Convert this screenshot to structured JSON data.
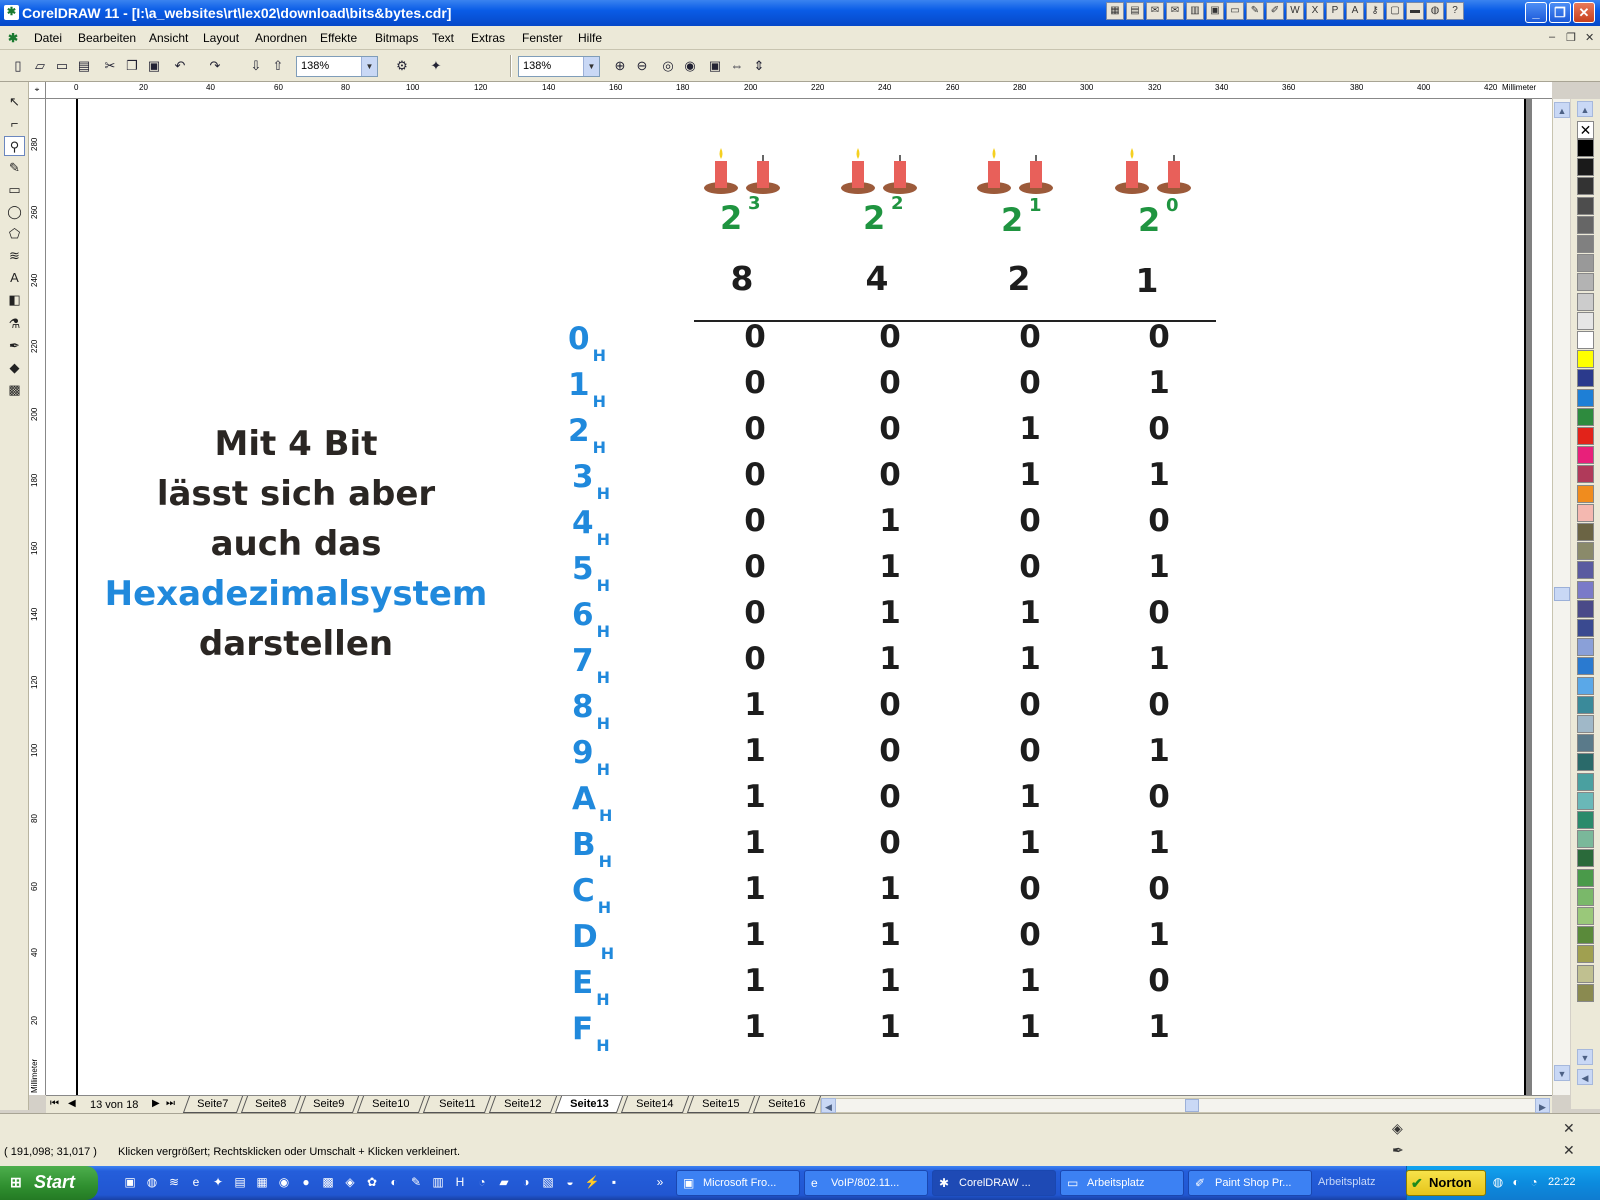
{
  "window": {
    "title": "CorelDRAW 11 - [I:\\a_websites\\rt\\lex02\\download\\bits&bytes.cdr]",
    "min_label": "_",
    "max_label": "❐",
    "close_label": "✕"
  },
  "menu": [
    "Datei",
    "Bearbeiten",
    "Ansicht",
    "Layout",
    "Anordnen",
    "Effekte",
    "Bitmaps",
    "Text",
    "Extras",
    "Fenster",
    "Hilfe"
  ],
  "toolbar": {
    "zoom1": "138%",
    "zoom2": "138%"
  },
  "ruler": {
    "unit": "Millimeter",
    "h_labels": [
      "0",
      "20",
      "40",
      "60",
      "80",
      "100",
      "120",
      "140",
      "160",
      "180",
      "200",
      "220",
      "240",
      "260",
      "280",
      "300",
      "320",
      "340",
      "360",
      "380",
      "400",
      "420"
    ],
    "v_labels": [
      "280",
      "260",
      "240",
      "220",
      "200",
      "180",
      "160",
      "140",
      "120",
      "100",
      "80",
      "60",
      "40",
      "20"
    ]
  },
  "slide": {
    "intro_lines": [
      "Mit 4 Bit",
      "lässt sich aber",
      "auch das"
    ],
    "intro_highlight": "Hexadezimalsystem",
    "intro_last": "darstellen",
    "powers": [
      {
        "base": "2",
        "exp": "3",
        "weight": "8"
      },
      {
        "base": "2",
        "exp": "2",
        "weight": "4"
      },
      {
        "base": "2",
        "exp": "1",
        "weight": "2"
      },
      {
        "base": "2",
        "exp": "0",
        "weight": "1"
      }
    ],
    "hex_suffix": "H",
    "rows": [
      {
        "hex": "0",
        "bits": [
          "0",
          "0",
          "0",
          "0"
        ]
      },
      {
        "hex": "1",
        "bits": [
          "0",
          "0",
          "0",
          "1"
        ]
      },
      {
        "hex": "2",
        "bits": [
          "0",
          "0",
          "1",
          "0"
        ]
      },
      {
        "hex": "3",
        "bits": [
          "0",
          "0",
          "1",
          "1"
        ]
      },
      {
        "hex": "4",
        "bits": [
          "0",
          "1",
          "0",
          "0"
        ]
      },
      {
        "hex": "5",
        "bits": [
          "0",
          "1",
          "0",
          "1"
        ]
      },
      {
        "hex": "6",
        "bits": [
          "0",
          "1",
          "1",
          "0"
        ]
      },
      {
        "hex": "7",
        "bits": [
          "0",
          "1",
          "1",
          "1"
        ]
      },
      {
        "hex": "8",
        "bits": [
          "1",
          "0",
          "0",
          "0"
        ]
      },
      {
        "hex": "9",
        "bits": [
          "1",
          "0",
          "0",
          "1"
        ]
      },
      {
        "hex": "A",
        "bits": [
          "1",
          "0",
          "1",
          "0"
        ]
      },
      {
        "hex": "B",
        "bits": [
          "1",
          "0",
          "1",
          "1"
        ]
      },
      {
        "hex": "C",
        "bits": [
          "1",
          "1",
          "0",
          "0"
        ]
      },
      {
        "hex": "D",
        "bits": [
          "1",
          "1",
          "0",
          "1"
        ]
      },
      {
        "hex": "E",
        "bits": [
          "1",
          "1",
          "1",
          "0"
        ]
      },
      {
        "hex": "F",
        "bits": [
          "1",
          "1",
          "1",
          "1"
        ]
      }
    ]
  },
  "pages": {
    "counter": "13 von 18",
    "tabs": [
      "Seite7",
      "Seite8",
      "Seite9",
      "Seite10",
      "Seite11",
      "Seite12",
      "Seite13",
      "Seite14",
      "Seite15",
      "Seite16"
    ],
    "active": "Seite13"
  },
  "status": {
    "coords": "( 191,098; 31,017 )",
    "hint": "Klicken vergrößert; Rechtsklicken oder Umschalt + Klicken verkleinert."
  },
  "palette": [
    "#000000",
    "#1a1a1a",
    "#333333",
    "#4d4d4d",
    "#666666",
    "#808080",
    "#999999",
    "#b3b3b3",
    "#cccccc",
    "#e6e6e6",
    "#ffffff",
    "#ffff00",
    "#2b3a8c",
    "#1e7fd6",
    "#2e8b3e",
    "#e2231a",
    "#e8207a",
    "#b03a5a",
    "#f08c1e",
    "#f4b8b0",
    "#6b6444",
    "#8a8a6a",
    "#5a5aa0",
    "#7a7ac8",
    "#4a4a88",
    "#3a4a90",
    "#8aa0d8",
    "#2a7ad0",
    "#5aa8e8",
    "#3a8a9a",
    "#a0b8c8",
    "#5a7a8a",
    "#2a6a6a",
    "#4aa0a0",
    "#6ab8b8",
    "#2a8a6a",
    "#7ab89a",
    "#2a6a3a",
    "#4a9a4a",
    "#7ab86a",
    "#9ac87a",
    "#5a8a3a",
    "#a0a050",
    "#c0c090",
    "#8a8a50"
  ],
  "taskbar": {
    "start": "Start",
    "tasks": [
      "Microsoft Fro...",
      "VoIP/802.11...",
      "CorelDRAW ...",
      "Arbeitsplatz",
      "Paint Shop Pr..."
    ],
    "tray_label": "Arbeitsplatz",
    "norton": "Norton",
    "clock": "22:22"
  }
}
